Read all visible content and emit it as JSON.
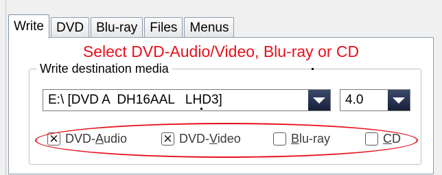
{
  "tabs": [
    {
      "label": "Write",
      "active": true
    },
    {
      "label": "DVD",
      "active": false
    },
    {
      "label": "Blu-ray",
      "active": false
    },
    {
      "label": "Files",
      "active": false
    },
    {
      "label": "Menus",
      "active": false
    }
  ],
  "instruction": "Select DVD-Audio/Video, Blu-ray or CD",
  "group": {
    "legend": "Write destination media",
    "drive": {
      "value": "E:\\ [DVD A  DH16AAL   LHD3]"
    },
    "speed": {
      "value": "4.0"
    },
    "options": [
      {
        "pre": "DVD-",
        "mnemonic": "A",
        "post": "udio",
        "checked": true
      },
      {
        "pre": "DVD-",
        "mnemonic": "V",
        "post": "ideo",
        "checked": true
      },
      {
        "pre": "",
        "mnemonic": "B",
        "post": "lu-ray",
        "checked": false
      },
      {
        "pre": "",
        "mnemonic": "C",
        "post": "D",
        "checked": false
      }
    ]
  },
  "colors": {
    "instruction": "#e8101c",
    "highlight": "#e8101c",
    "dropdown_button": "#1e2a48"
  },
  "icons": {
    "checked_mark": "✕",
    "dropdown": "chevron-down-icon"
  }
}
